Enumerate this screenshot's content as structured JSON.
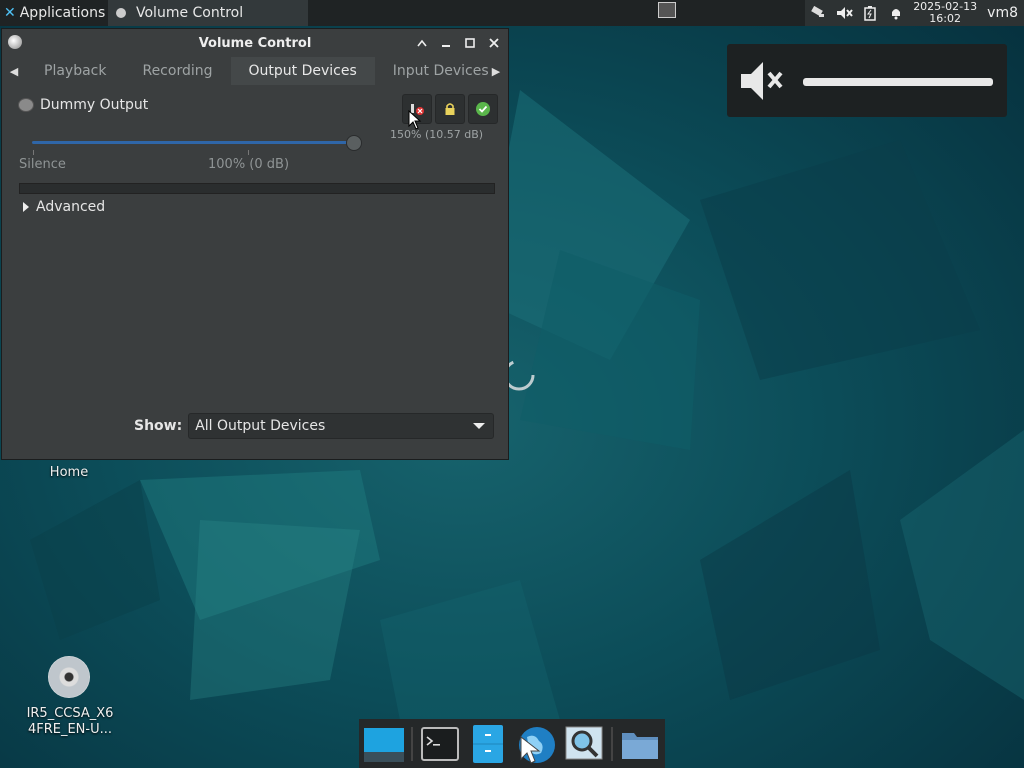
{
  "top_panel": {
    "applications_label": "Applications",
    "task": {
      "title": "Volume Control"
    },
    "clock": {
      "date": "2025-02-13",
      "time": "16:02"
    },
    "user": "vm8",
    "tray_icons": [
      "network-icon",
      "volume-muted-icon",
      "battery-icon",
      "notification-icon"
    ]
  },
  "window": {
    "title": "Volume Control",
    "tabs": [
      {
        "label": "Playback",
        "active": false
      },
      {
        "label": "Recording",
        "active": false
      },
      {
        "label": "Output Devices",
        "active": true
      },
      {
        "label": "Input Devices",
        "active": false
      }
    ],
    "device": {
      "name": "Dummy Output",
      "volume_readout": "150% (10.57 dB)",
      "volume_fraction": 1.5,
      "muted": true,
      "locked": true,
      "default": true
    },
    "scale_labels": {
      "silence": "Silence",
      "hundred": "100% (0 dB)"
    },
    "advanced_label": "Advanced",
    "show": {
      "label": "Show:",
      "value": "All Output Devices"
    }
  },
  "osd": {
    "icon": "volume-muted-icon",
    "level_fraction": 1.0
  },
  "desktop": {
    "home_label": "Home",
    "disc_label_line1": "IR5_CCSA_X6",
    "disc_label_line2": "4FRE_EN-U..."
  },
  "dock": {
    "items": [
      "show-desktop-icon",
      "terminal-icon",
      "file-manager-icon",
      "web-browser-icon",
      "app-finder-icon",
      "folder-icon"
    ]
  }
}
